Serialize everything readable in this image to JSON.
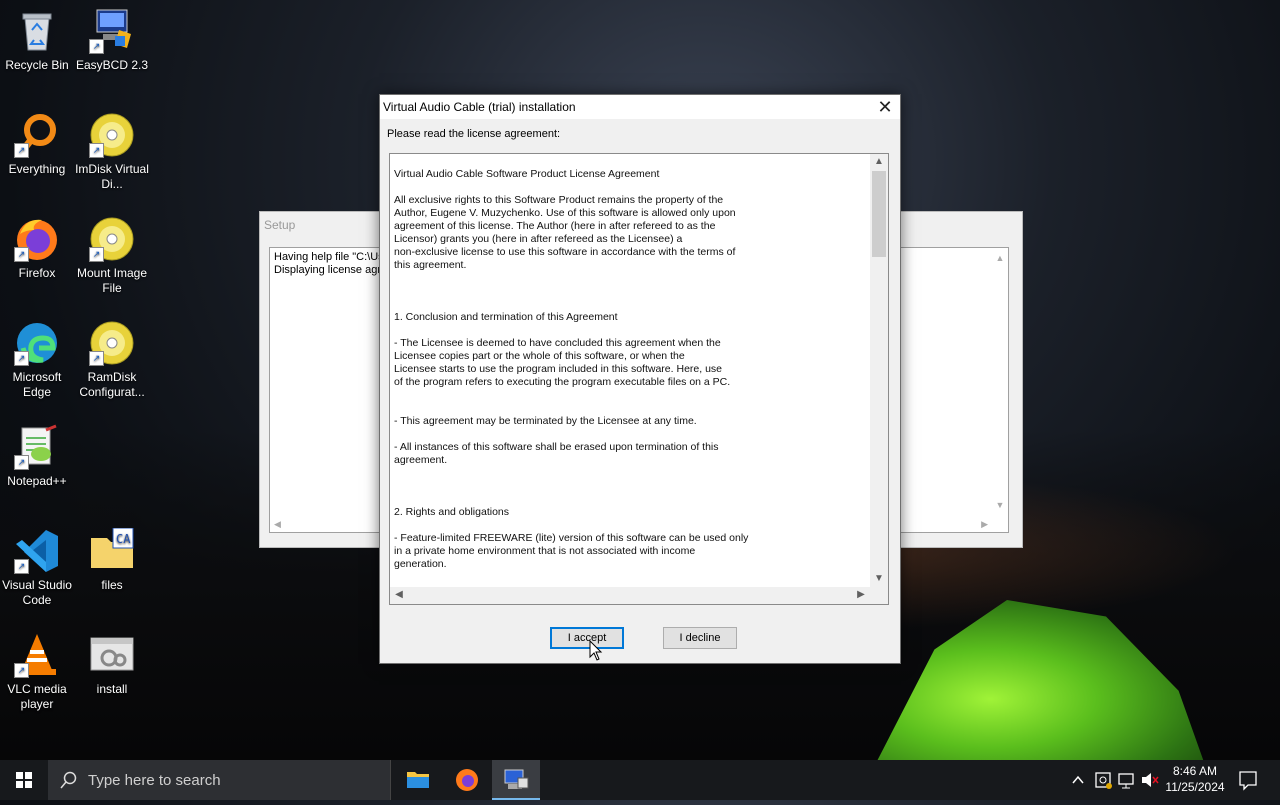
{
  "desktop": {
    "icons": [
      {
        "label": "Recycle Bin",
        "icon": "recycle-bin-icon"
      },
      {
        "label": "EasyBCD 2.3",
        "icon": "easybcd-icon"
      },
      {
        "label": "Everything",
        "icon": "everything-icon"
      },
      {
        "label": "ImDisk Virtual Di...",
        "icon": "imdisk-icon"
      },
      {
        "label": "Firefox",
        "icon": "firefox-icon"
      },
      {
        "label": "Mount Image File",
        "icon": "mount-image-icon"
      },
      {
        "label": "Microsoft Edge",
        "icon": "edge-icon"
      },
      {
        "label": "RamDisk Configurat...",
        "icon": "ramdisk-icon"
      },
      {
        "label": "Notepad++",
        "icon": "notepadpp-icon"
      },
      {
        "label": "Visual Studio Code",
        "icon": "vscode-icon"
      },
      {
        "label": "files",
        "icon": "folder-icon"
      },
      {
        "label": "VLC media player",
        "icon": "vlc-icon"
      },
      {
        "label": "install",
        "icon": "install-icon"
      }
    ]
  },
  "setup_window": {
    "title": "Setup",
    "log_lines": [
      "Having help file \"C:\\Us",
      "Displaying license agre"
    ]
  },
  "dialog": {
    "title": "Virtual Audio Cable (trial) installation",
    "prompt": "Please read the license agreement:",
    "license_paragraphs": [
      "Virtual Audio Cable Software Product License Agreement",
      "All exclusive rights to this Software Product remains the property of the\nAuthor, Eugene V. Muzychenko. Use of this software is allowed only upon\nagreement of this license. The Author (here in after refereed to as the\nLicensor) grants you (here in after refereed as the Licensee) a\nnon-exclusive license to use this software in accordance with the terms of\nthis agreement.",
      "1. Conclusion and termination of this Agreement",
      "- The Licensee is deemed to have concluded this agreement when the\nLicensee copies part or the whole of this software, or when the\nLicensee starts to use the program included in this software. Here, use\nof the program refers to executing the program executable files on a PC.",
      "- This agreement may be terminated by the Licensee at any time.",
      "- All instances of this software shall be erased upon termination of this\nagreement.",
      "2. Rights and obligations",
      "- Feature-limited FREEWARE (lite) version of this software can be used only\nin a private home environment that is not associated with income\ngeneration."
    ],
    "accept_label": "I accept",
    "decline_label": "I decline"
  },
  "taskbar": {
    "search_placeholder": "Type here to search",
    "pinned": [
      "file-explorer-icon",
      "firefox-icon",
      "installer-icon"
    ],
    "time": "8:46 AM",
    "date": "11/25/2024"
  }
}
